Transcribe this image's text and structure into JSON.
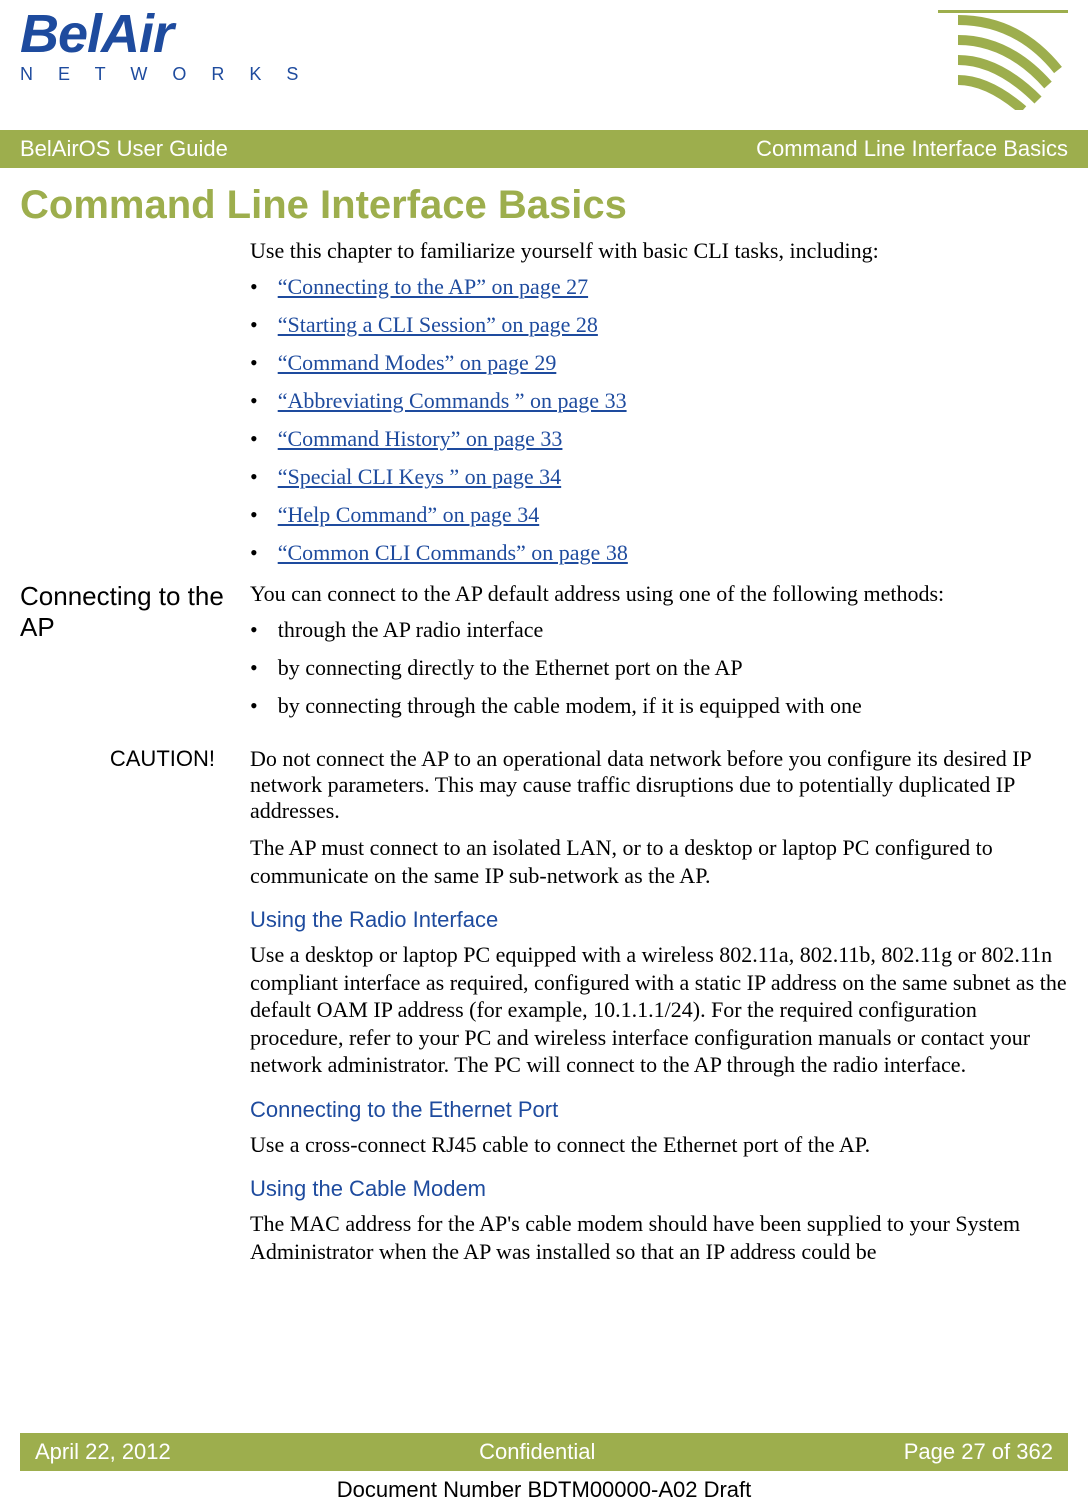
{
  "logo": {
    "brand": "BelAir",
    "subbrand": "N E T W O R K S"
  },
  "titlebar": {
    "left": "BelAirOS User Guide",
    "right": "Command Line Interface Basics"
  },
  "page_title": "Command Line Interface Basics",
  "intro": "Use this chapter to familiarize yourself with basic CLI tasks, including:",
  "links": [
    "“Connecting to the AP” on page 27",
    "“Starting a CLI Session” on page 28",
    "“Command Modes” on page 29",
    "“Abbreviating Commands ” on page 33",
    "“Command History” on page 33",
    "“Special CLI Keys ” on page 34",
    "“Help Command” on page 34",
    "“Common CLI Commands” on page 38"
  ],
  "sect1": {
    "label": "Connecting to the AP",
    "intro": "You can connect to the AP default address using one of the following methods:",
    "bullets": [
      "through the AP radio interface",
      "by connecting directly to the Ethernet port on the AP",
      "by connecting through the cable modem, if it is equipped with one"
    ]
  },
  "caution": {
    "label": "CAUTION!",
    "text": "Do not connect the AP to an operational data network before you configure its desired IP network parameters. This may cause traffic disruptions due to potentially duplicated IP addresses."
  },
  "para_isolated": "The AP must connect to an isolated LAN, or to a desktop or laptop PC configured to communicate on the same IP sub-network as the AP.",
  "sub_radio": {
    "heading": "Using the Radio Interface",
    "text": "Use a desktop or laptop PC equipped with a wireless 802.11a, 802.11b, 802.11g or 802.11n compliant interface as required, configured with a static IP address on the same subnet as the default OAM IP address (for example, 10.1.1.1/24). For the required configuration procedure, refer to your PC and wireless interface configuration manuals or contact your network administrator. The PC will connect to the AP through the radio interface."
  },
  "sub_eth": {
    "heading": "Connecting to the Ethernet Port",
    "text": "Use a cross-connect RJ45 cable to connect the Ethernet port of the AP."
  },
  "sub_modem": {
    "heading": "Using the Cable Modem",
    "text": "The MAC address for the AP's cable modem should have been supplied to your System Administrator when the AP was installed so that an IP address could be"
  },
  "footer": {
    "date": "April 22, 2012",
    "conf": "Confidential",
    "page": "Page 27 of 362"
  },
  "docnum": "Document Number BDTM00000-A02 Draft"
}
